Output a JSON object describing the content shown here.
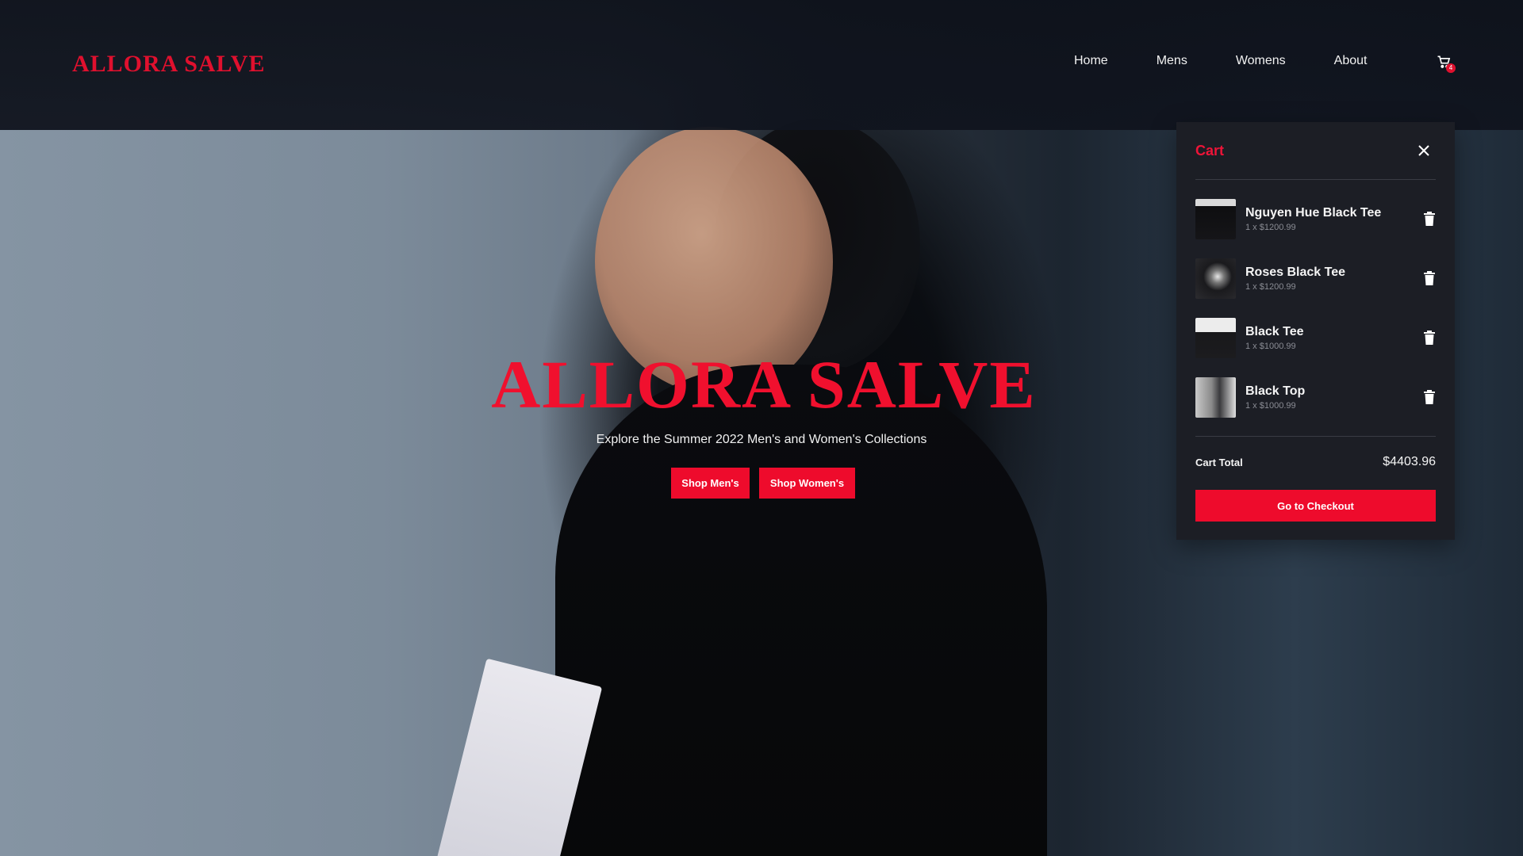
{
  "brand": "ALLORA SALVE",
  "nav": {
    "links": [
      {
        "label": "Home"
      },
      {
        "label": "Mens"
      },
      {
        "label": "Womens"
      },
      {
        "label": "About"
      }
    ],
    "cart_icon": "cart-icon",
    "cart_count": "4"
  },
  "hero": {
    "title": "ALLORA SALVE",
    "subtitle": "Explore the Summer 2022 Men's and Women's Collections",
    "buttons": {
      "shop_men": "Shop Men's",
      "shop_women": "Shop Women's"
    }
  },
  "cart": {
    "title": "Cart",
    "close_icon": "close-icon",
    "items": [
      {
        "name": "Nguyen Hue Black Tee",
        "qty_price": "1 x $1200.99"
      },
      {
        "name": "Roses Black Tee",
        "qty_price": "1 x $1200.99"
      },
      {
        "name": "Black Tee",
        "qty_price": "1 x $1000.99"
      },
      {
        "name": "Black Top",
        "qty_price": "1 x $1000.99"
      }
    ],
    "total_label": "Cart Total",
    "total_value": "$4403.96",
    "checkout_label": "Go to Checkout"
  },
  "colors": {
    "accent": "#ee0b2c",
    "panel": "#1c1e25",
    "navbar": "#10141e"
  }
}
